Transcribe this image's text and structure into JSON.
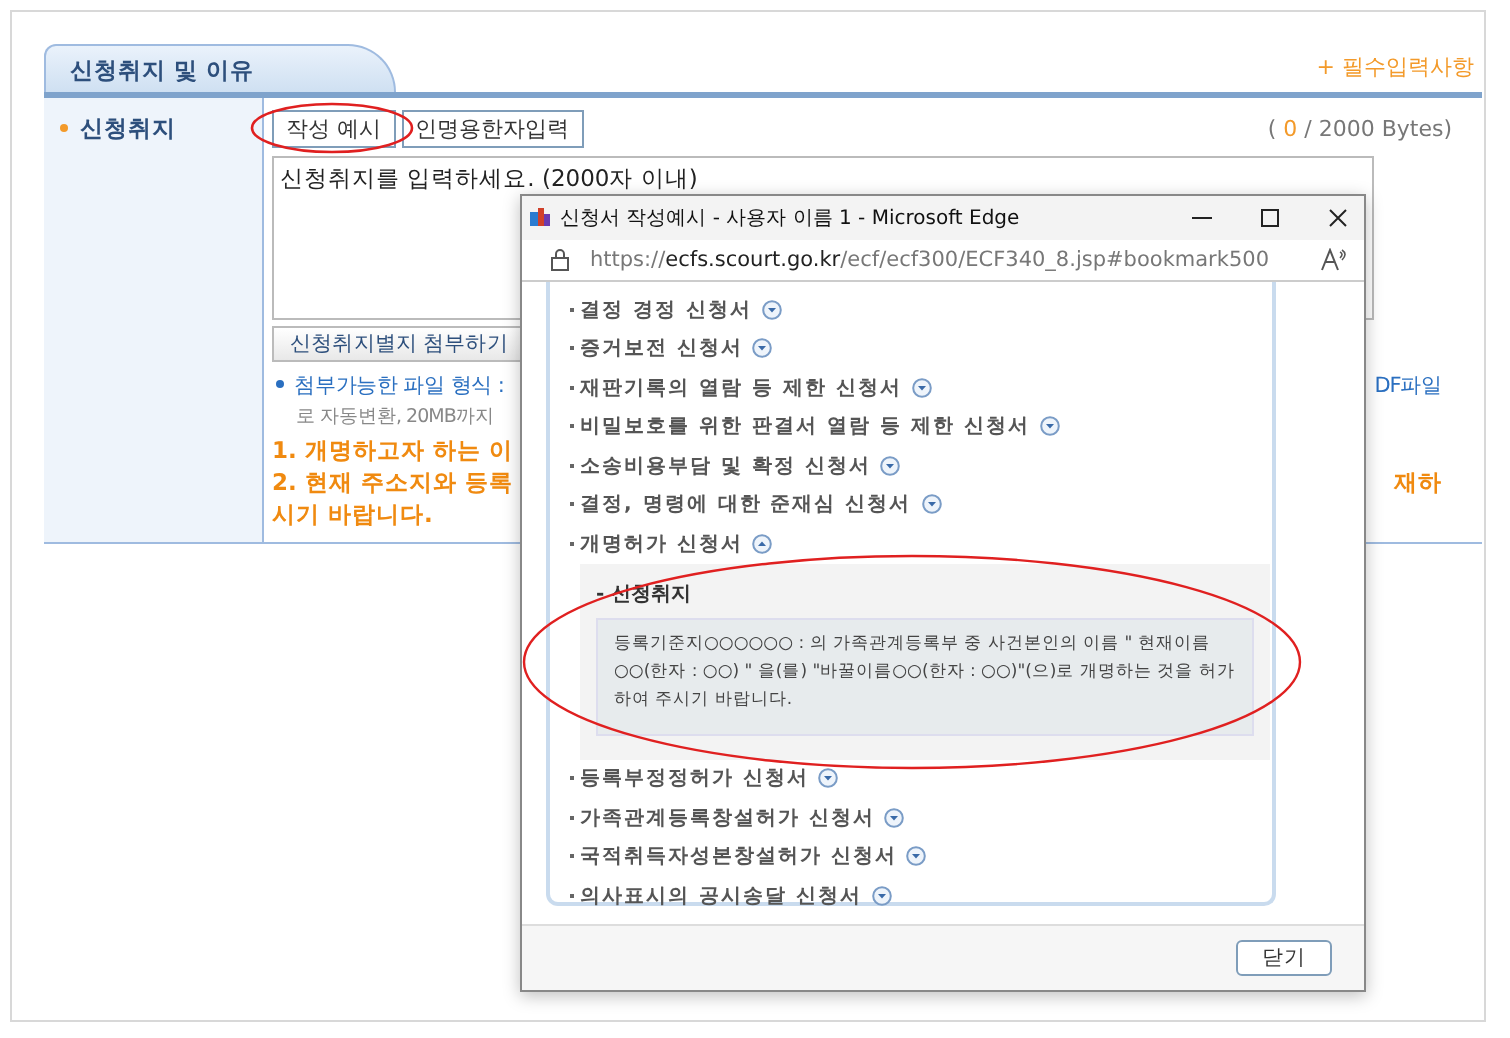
{
  "section": {
    "title": "신청취지 및 이유",
    "required_note": "+ 필수입력사항"
  },
  "field": {
    "label": "신청취지",
    "buttons": [
      {
        "label": "작성 예시",
        "circled": true
      },
      {
        "label": "인명용한자입력",
        "circled": false
      }
    ],
    "byte_counter": {
      "open": "(",
      "current": "0",
      "rest": "/ 2000 Bytes)"
    },
    "textarea": {
      "placeholder": "신청취지를 입력하세요. (2000자 이내)"
    },
    "attach_button": "신청취지별지 첨부하기",
    "notes": [
      {
        "kind": "info",
        "left": "첨부가능한 파일 형식 :",
        "right": "DF파일"
      },
      {
        "kind": "info-cont",
        "left": "로 자동변환, 20MB까지"
      },
      {
        "kind": "warn",
        "left": "1. 개명하고자 하는 이"
      },
      {
        "kind": "warn",
        "left": "2. 현재 주소지와 등록",
        "right": "재하"
      },
      {
        "kind": "warn",
        "left": "시기 바랍니다."
      }
    ]
  },
  "popup": {
    "title": "신청서 작성예시 - 사용자 이름 1 - Microsoft Edge",
    "url_scheme": "https://",
    "url_host": "ecfs.scourt.go.kr",
    "url_path": "/ecf/ecf300/ECF340_8.jsp#bookmark500",
    "items": [
      {
        "label": "결정 경정 신청서",
        "expanded": false
      },
      {
        "label": "증거보전 신청서",
        "expanded": false
      },
      {
        "label": "재판기록의 열람 등 제한 신청서",
        "expanded": false
      },
      {
        "label": "비밀보호를 위한 판결서 열람 등 제한 신청서",
        "expanded": false
      },
      {
        "label": "소송비용부담 및 확정 신청서",
        "expanded": false
      },
      {
        "label": "결정, 명령에 대한 준재심 신청서",
        "expanded": false
      },
      {
        "label": "개명허가 신청서",
        "expanded": true,
        "detail": {
          "heading": "- 신청취지",
          "text": "등록기준지○○○○○○ : 의 가족관계등록부 중 사건본인의 이름 \" 현재이름 ○○(한자 : ○○) \" 을(를) \"바꿀이름○○(한자 : ○○)\"(으)로 개명하는 것을 허가하여 주시기 바랍니다.",
          "circled": true
        }
      },
      {
        "label": "등록부정정허가 신청서",
        "expanded": false
      },
      {
        "label": "가족관계등록창설허가 신청서",
        "expanded": false
      },
      {
        "label": "국적취득자성본창설허가 신청서",
        "expanded": false
      },
      {
        "label": "의사표시의 공시송달 신청서",
        "expanded": false
      }
    ],
    "close_button": "닫기"
  }
}
